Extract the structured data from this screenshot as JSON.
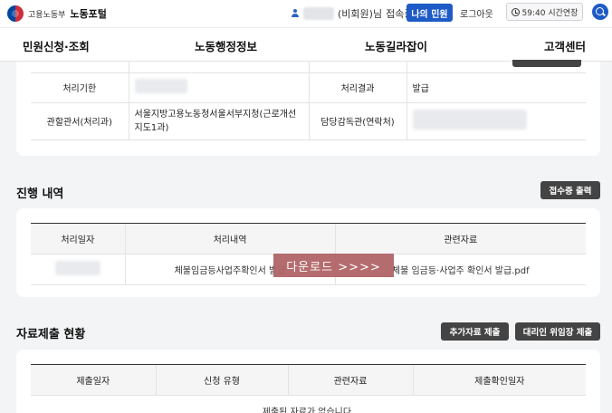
{
  "header": {
    "logo_ministry": "고용노동부",
    "logo_portal": "노동포털",
    "user_suffix": "(비회원)님",
    "user_status": "접속중",
    "my_complaint": "나의 민원",
    "logout": "로그아웃",
    "session_extend": "59:40 시간연장"
  },
  "nav": {
    "items": [
      "민원신청·조회",
      "노동행정정보",
      "노동길라잡이",
      "고객센터"
    ]
  },
  "detail": {
    "deadline_label": "처리기한",
    "result_label": "처리결과",
    "result_value": "발급",
    "office_label": "관할관서(처리과)",
    "office_value": "서울지방고용노동청서울서부지청(근로개선지도1과)",
    "inspector_label": "담당감독관(연락처)"
  },
  "progress": {
    "title": "진행 내역",
    "print_button": "접수증 출력",
    "columns": [
      "처리일자",
      "처리내역",
      "관련자료"
    ],
    "rows": [
      {
        "history": "체불임금등사업주확인서 발급",
        "file": "체불 임금등·사업주 확인서 발급.pdf"
      }
    ]
  },
  "download_banner": "다운로드 >>>>",
  "submission": {
    "title": "자료제출 현황",
    "add_button": "추가자료 제출",
    "delegate_button": "대리인 위임장 제출",
    "columns": [
      "제출일자",
      "신청 유형",
      "관련자료",
      "제출확인일자"
    ],
    "empty_message": "제출된 자료가 없습니다."
  },
  "colors": {
    "primary": "#1e5bc6",
    "dark_button": "#444444",
    "download_overlay": "#b06567"
  }
}
